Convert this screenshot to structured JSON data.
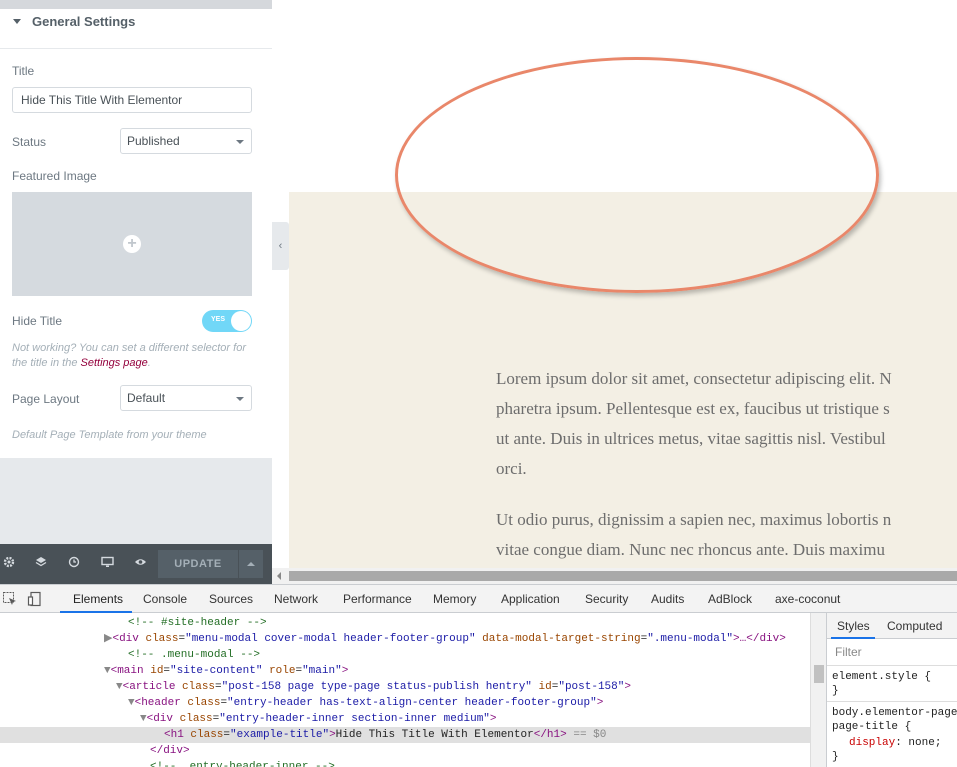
{
  "panel": {
    "section_title": "General Settings",
    "title_label": "Title",
    "title_value": "Hide This Title With Elementor",
    "status_label": "Status",
    "status_value": "Published",
    "featured_image_label": "Featured Image",
    "hide_title_label": "Hide Title",
    "hide_title_toggle_text": "YES",
    "help_text_1": "Not working? You can set a different selector for",
    "help_text_2": "the title in the",
    "help_link": "Settings page",
    "help_text_end": ".",
    "page_layout_label": "Page Layout",
    "page_layout_value": "Default",
    "page_layout_help": "Default Page Template from your theme"
  },
  "footer": {
    "update_label": "UPDATE",
    "icons": [
      "gear-icon",
      "layers-icon",
      "history-icon",
      "responsive-icon",
      "preview-eye-icon"
    ]
  },
  "preview": {
    "para1": [
      "Lorem ipsum dolor sit amet, consectetur adipiscing elit. N",
      "pharetra ipsum. Pellentesque est ex, faucibus ut tristique s",
      "ut ante. Duis in ultrices metus, vitae sagittis nisl. Vestibul",
      "orci."
    ],
    "para2": [
      "Ut odio purus, dignissim a sapien nec, maximus lobortis n",
      "vitae congue diam. Nunc nec rhoncus ante. Duis maximu"
    ],
    "highlight_color": "#e9876a"
  },
  "devtools": {
    "tabs": [
      "Elements",
      "Console",
      "Sources",
      "Network",
      "Performance",
      "Memory",
      "Application",
      "Security",
      "Audits",
      "AdBlock",
      "axe-coconut"
    ],
    "active_tab": "Elements",
    "dom": {
      "l1": "<!-- #site-header -->",
      "l2_tag_open": "<div ",
      "l2_attr1": "class",
      "l2_val1": "\"menu-modal cover-modal header-footer-group\"",
      "l2_attr2": "data-modal-target-string",
      "l2_val2": "\".menu-modal\"",
      "l2_end": ">…</div>",
      "l3": "<!-- .menu-modal -->",
      "l4_open": "<main ",
      "l4_a1": "id",
      "l4_v1": "\"site-content\"",
      "l4_a2": "role",
      "l4_v2": "\"main\"",
      "l4_close": ">",
      "l5_open": "<article ",
      "l5_a1": "class",
      "l5_v1": "\"post-158 page type-page status-publish hentry\"",
      "l5_a2": "id",
      "l5_v2": "\"post-158\"",
      "l5_close": ">",
      "l6_open": "<header ",
      "l6_a1": "class",
      "l6_v1": "\"entry-header has-text-align-center header-footer-group\"",
      "l6_close": ">",
      "l7_open": "<div ",
      "l7_a1": "class",
      "l7_v1": "\"entry-header-inner section-inner medium\"",
      "l7_close": ">",
      "l8_open": "<h1 ",
      "l8_a1": "class",
      "l8_v1": "\"example-title\"",
      "l8_text": "Hide This Title With Elementor",
      "l8_close": "</h1>",
      "l8_marker": "== $0",
      "l9": "</div>",
      "l10": "<!-- .entry-header-inner -->"
    },
    "styles": {
      "tab_styles": "Styles",
      "tab_computed": "Computed",
      "filter_placeholder": "Filter",
      "rule1_selector": "element.style {",
      "rule1_end": "}",
      "rule2_selector_1": "body.elementor-page",
      "rule2_selector_2": "page-title {",
      "rule2_prop": "display",
      "rule2_value": "none;",
      "rule2_end": "}"
    }
  }
}
